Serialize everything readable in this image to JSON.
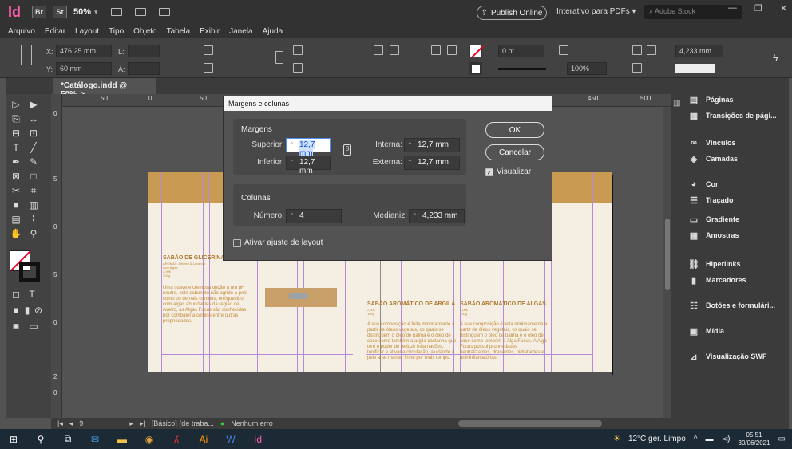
{
  "app": {
    "logo": "Id",
    "bridge": "Br",
    "stock": "St",
    "zoom": "50%",
    "publish": "Publish Online",
    "workspace": "Interativo para PDFs",
    "search_placeholder": "Adobe Stock"
  },
  "menu": [
    "Arquivo",
    "Editar",
    "Layout",
    "Tipo",
    "Objeto",
    "Tabela",
    "Exibir",
    "Janela",
    "Ajuda"
  ],
  "control": {
    "x_label": "X:",
    "x_value": "476,25 mm",
    "y_label": "Y:",
    "y_value": "60 mm",
    "l_label": "L:",
    "a_label": "A:",
    "stroke_weight": "0 pt",
    "opacity": "100%",
    "gutter": "4,233 mm"
  },
  "tab": {
    "title": "*Catálogo.indd @ 50%",
    "close": "×"
  },
  "ruler": {
    "h_ticks": [
      "50",
      "0",
      "50",
      "450",
      "500"
    ],
    "v_ticks": [
      "0",
      "5",
      "0",
      "5",
      "0",
      "2",
      "0"
    ]
  },
  "page": {
    "left_title": "SABÃO DE GLICERINA",
    "left_sub": "AROMAS: Alecrim & Lavanda\ncom Algas\n2,00€\n100g",
    "left_body": "Uma suave e cremosa opção a um pH neutro, este sabonete não agride a pele como os demais comuns, enriquecido com algas abundantes da região de Aveiro, as Algas Fucus são conhecidas por combater a celulite entre outras propriedades.",
    "mid_title": "SABÃO AROMÁTICO DE ARGILA",
    "mid_sub": "2,00€\n100g",
    "mid_body": "A sua composição é feita minimamente a partir de óleos vegetais, os quais se distinguem o óleo de palma e o óleo de coco como também a argila castanha que tem o poder de reduzir inflamações, tonificar e ativar a circulação, ajudando a pele a se manter firme por mais tempo.",
    "right_title": "SABÃO AROMÁTICO DE ALGAS",
    "right_sub": "2,00€\n100g",
    "right_body": "A sua composição é feita minimamente a partir de óleos vegetais, os quais se distinguem o óleo de palma e o óleo de coco como também a Alga Fucus. A Alga Fucus possui propriedades neutralizantes, drenantes, hidratantes e anti-inflamatórias."
  },
  "status": {
    "page": "9",
    "master": "[Básico] (de traba...",
    "errors": "Nenhum erro"
  },
  "panels": [
    "Páginas",
    "Transições de pági...",
    "Vínculos",
    "Camadas",
    "Cor",
    "Traçado",
    "Gradiente",
    "Amostras",
    "Hiperlinks",
    "Marcadores",
    "Botões e formulári...",
    "Mídia",
    "Visualização SWF"
  ],
  "dialog": {
    "title": "Margens e colunas",
    "margins_label": "Margens",
    "superior_label": "Superior:",
    "superior_value": "12,7 mm",
    "inferior_label": "Inferior:",
    "inferior_value": "12,7 mm",
    "interna_label": "Interna:",
    "interna_value": "12,7 mm",
    "externa_label": "Externa:",
    "externa_value": "12,7 mm",
    "columns_label": "Colunas",
    "numero_label": "Número:",
    "numero_value": "4",
    "medianiz_label": "Medianiz:",
    "medianiz_value": "4,233 mm",
    "layout_adjust_label": "Ativar ajuste de layout",
    "ok": "OK",
    "cancel": "Cancelar",
    "preview": "Visualizar",
    "preview_checked": true
  },
  "taskbar": {
    "weather": "12°C ger. Limpo",
    "time": "05:51",
    "date": "30/06/2021"
  }
}
